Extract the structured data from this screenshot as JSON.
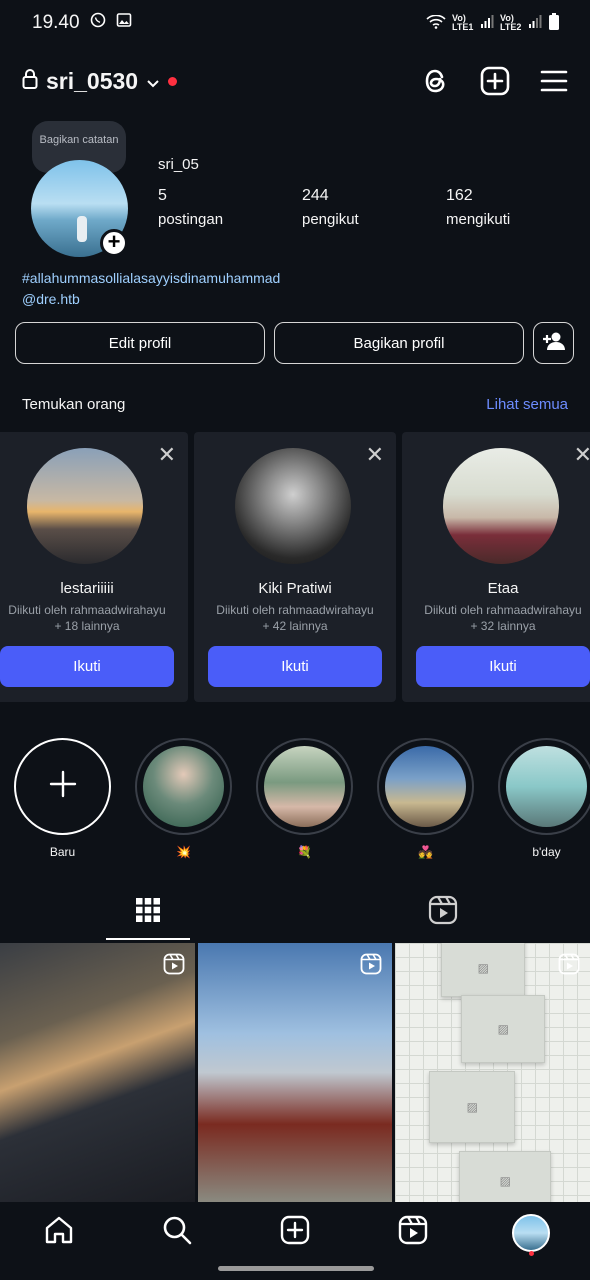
{
  "status": {
    "time": "19.40",
    "sim1": "Vo) LTE1",
    "sim2": "Vo) LTE2"
  },
  "header": {
    "username": "sri_0530"
  },
  "profile": {
    "note": "Bagikan catatan",
    "display_name": "sri_05",
    "stats": [
      {
        "value": "5",
        "label": "postingan"
      },
      {
        "value": "244",
        "label": "pengikut"
      },
      {
        "value": "162",
        "label": "mengikuti"
      }
    ],
    "bio_tag": "#allahummasollialasayyisdinamuhammad",
    "bio_link": "@dre.htb"
  },
  "actions": {
    "edit": "Edit profil",
    "share": "Bagikan profil"
  },
  "discover": {
    "title": "Temukan orang",
    "see_all": "Lihat semua",
    "cards": [
      {
        "name": "lestariiiii",
        "line1": "Diikuti oleh rahmaadwirahayu",
        "line2": "+ 18 lainnya",
        "button": "Ikuti"
      },
      {
        "name": "Kiki Pratiwi",
        "line1": "Diikuti oleh rahmaadwirahayu",
        "line2": "+ 42 lainnya",
        "button": "Ikuti"
      },
      {
        "name": "Etaa",
        "line1": "Diikuti oleh rahmaadwirahayu",
        "line2": "+ 32 lainnya",
        "button": "Ikuti"
      }
    ]
  },
  "highlights": [
    {
      "label": "Baru"
    },
    {
      "label": "💥"
    },
    {
      "label": "💐"
    },
    {
      "label": "💑"
    },
    {
      "label": "b'day"
    }
  ],
  "colors": {
    "background": "#0d1117",
    "accent": "#4a5df9",
    "link": "#6d8cff",
    "notification": "#ff3040"
  }
}
